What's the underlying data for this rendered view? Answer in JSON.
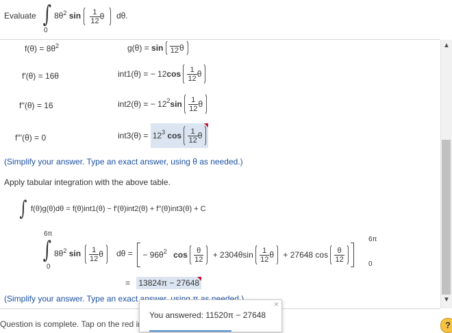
{
  "question": {
    "evaluate_label": "Evaluate",
    "integrand_lower": "0",
    "integrand_expr": "8θ",
    "integrand_exp": "2",
    "sin": "sin",
    "frac_num": "1",
    "frac_den": "12",
    "theta": "θ",
    "dtheta": "dθ."
  },
  "table": {
    "f0_label": "f(θ) =",
    "f0_val": "8θ",
    "f0_exp": "2",
    "g_label": "g(θ) =",
    "g_sin": "sin",
    "f1_label": "f′(θ) =",
    "f1_val": "16θ",
    "int1_label": "int1(θ) =",
    "int1_coef": "− 12",
    "int1_func": "cos",
    "f2_label": "f′′(θ) =",
    "f2_val": "16",
    "int2_label": "int2(θ) =",
    "int2_coef": "− 12",
    "int2_exp": "2",
    "int2_func": "sin",
    "f3_label": "f′′′(θ) =",
    "f3_val": "0",
    "int3_label": "int3(θ) =",
    "int3_coef": "12",
    "int3_exp": "3",
    "int3_func": "cos"
  },
  "hint1": "(Simplify your answer. Type an exact answer, using θ as needed.)",
  "instruction": "Apply tabular integration with the above table.",
  "formula": "f(θ)g(θ)dθ = f(θ)int1(θ) − f′(θ)int2(θ) + f′′(θ)int3(θ) + C",
  "definite": {
    "upper": "6π",
    "lower": "0",
    "lhs_expr": "8θ",
    "lhs_exp": "2",
    "sin": "sin",
    "equals_d": "dθ =",
    "term1_coef": "− 96θ",
    "term1_exp": "2",
    "cos": "cos",
    "th_num": "θ",
    "th_den": "12",
    "term2": "+ 2304θsin",
    "term3": "+ 27648 cos",
    "eval_upper": "6π",
    "eval_lower": "0"
  },
  "answer": {
    "equals": "=",
    "value": "13824π − 27648"
  },
  "hint2": "(Simplify your answer. Type an exact answer, using π as needed.)",
  "status": "Question is complete. Tap on the red indicators to see incorrect answers.",
  "popup": {
    "close": "×",
    "text": "You answered: 11520π − 27648"
  },
  "help_label": "?",
  "colors": {
    "highlight": "#dbe5f1",
    "indicator": "#c8102e",
    "hint": "#1a4fa0"
  }
}
